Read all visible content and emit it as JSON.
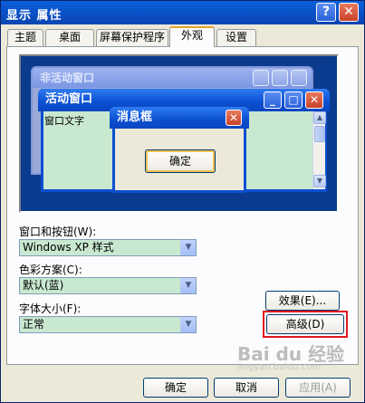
{
  "window": {
    "title": "显示 属性",
    "help_label": "?",
    "close_label": "✕"
  },
  "tabs": [
    "主题",
    "桌面",
    "屏幕保护程序",
    "外观",
    "设置"
  ],
  "active_tab_index": 3,
  "preview": {
    "inactive_window_title": "非活动窗口",
    "active_window_title": "活动窗口",
    "window_text": "窗口文字",
    "message_box_title": "消息框",
    "ok_label": "确定"
  },
  "form": {
    "window_buttons": {
      "label": "窗口和按钮(W):",
      "value": "Windows XP 样式"
    },
    "color_scheme": {
      "label": "色彩方案(C):",
      "value": "默认(蓝)"
    },
    "font_size": {
      "label": "字体大小(F):",
      "value": "正常"
    },
    "effects_label": "效果(E)...",
    "advanced_label": "高级(D)"
  },
  "footer": {
    "ok_label": "确定",
    "cancel_label": "取消",
    "apply_label": "应用(A)"
  },
  "watermark": {
    "line1": "Bai du 经验",
    "line2": "jingyan.baidu.com"
  },
  "colors": {
    "title_blue": "#0b4fd1",
    "window_face": "#ece9d8",
    "selection_green": "#c9e8d0",
    "highlight_red": "#e0161b"
  }
}
